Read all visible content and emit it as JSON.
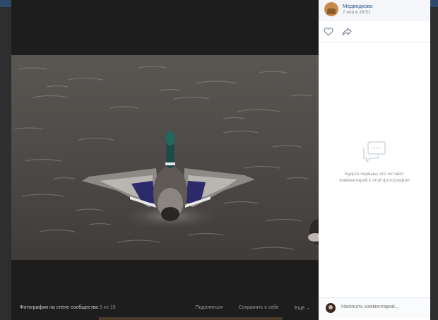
{
  "post": {
    "author": "Медведково",
    "date": "7 ноя в 16:51"
  },
  "comments": {
    "empty_text": "Будьте первым, кто оставит комментарий к этой фотографии",
    "input_placeholder": "Написать комментарий..."
  },
  "viewer": {
    "album_title": "Фотографии на стене сообщества",
    "counter": "9 из 10",
    "share_label": "Поделиться",
    "save_label": "Сохранить к себе",
    "more_label": "Ещё ⌄"
  },
  "icons": {
    "like": "heart-icon",
    "share": "share-arrow-icon",
    "comments_placeholder": "speech-bubble-icon"
  },
  "colors": {
    "link": "#2a5885",
    "viewer_bg": "#1d1d1d",
    "topbar": "#2f4a6b"
  }
}
